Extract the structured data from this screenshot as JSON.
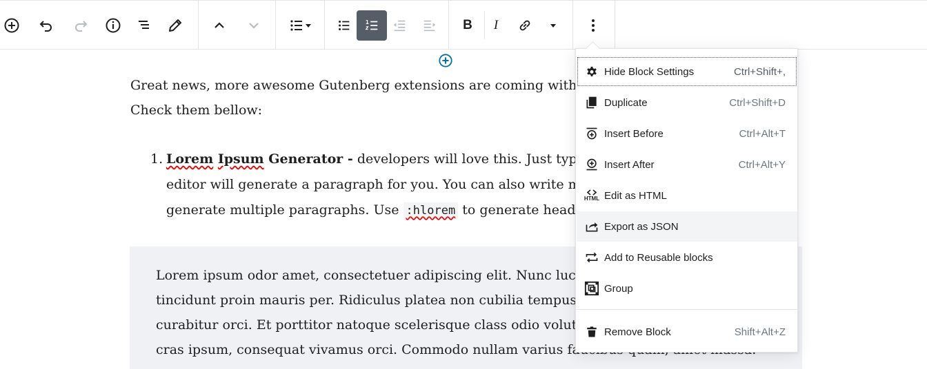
{
  "toolbar": {
    "buttons": {
      "add_block": "add-block",
      "undo": "undo",
      "redo": "redo",
      "info": "info",
      "outline": "outline",
      "edit": "edit",
      "move_up": "move-up",
      "move_down": "move-down",
      "list_type": "list-type",
      "unordered": "unordered-list",
      "ordered": "ordered-list",
      "outdent": "outdent",
      "indent": "indent",
      "bold": "B",
      "italic": "I",
      "link": "link",
      "more_rich": "more-rich-text",
      "more_options": "more-options"
    }
  },
  "editor": {
    "paragraph_line1": "Great news, more awesome Gutenberg extensions are coming with V",
    "paragraph_line2": "Check them bellow:",
    "list": {
      "number": "1.",
      "bold_words": [
        "Lorem",
        "Ipsum",
        "Generator -"
      ],
      "line1_rest": " developers will love this. Just type",
      "line2": "editor will generate a paragraph for you. You can also write mo",
      "line3_pre": "generate multiple paragraphs. Use ",
      "line3_code": ":hlorem",
      "line3_post": " to generate headin"
    },
    "quote_lines": [
      "Lorem ipsum odor amet, consectetuer adipiscing elit. Nunc luctus",
      "tincidunt proin mauris per. Ridiculus platea non cubilia tempus",
      "curabitur orci. Et porttitor natoque scelerisque class odio volutp",
      "cras ipsum, consequat vivamus orci. Commodo nullam varius faucibus quam, amet massa."
    ]
  },
  "menu": {
    "items": [
      {
        "label": "Hide Block Settings",
        "shortcut": "Ctrl+Shift+,",
        "icon": "gear-icon"
      },
      {
        "label": "Duplicate",
        "shortcut": "Ctrl+Shift+D",
        "icon": "duplicate-icon"
      },
      {
        "label": "Insert Before",
        "shortcut": "Ctrl+Alt+T",
        "icon": "insert-before-icon"
      },
      {
        "label": "Insert After",
        "shortcut": "Ctrl+Alt+Y",
        "icon": "insert-after-icon"
      },
      {
        "label": "Edit as HTML",
        "shortcut": "",
        "icon": "html-icon"
      },
      {
        "label": "Export as JSON",
        "shortcut": "",
        "icon": "export-icon"
      },
      {
        "label": "Add to Reusable blocks",
        "shortcut": "",
        "icon": "reusable-icon"
      },
      {
        "label": "Group",
        "shortcut": "",
        "icon": "group-icon"
      },
      {
        "label": "Remove Block",
        "shortcut": "Shift+Alt+Z",
        "icon": "trash-icon"
      }
    ],
    "html_icon_text": "HTML"
  },
  "colors": {
    "accent": "#0073aa",
    "active_button": "#555d66",
    "quote_background": "#f0f1f4"
  }
}
